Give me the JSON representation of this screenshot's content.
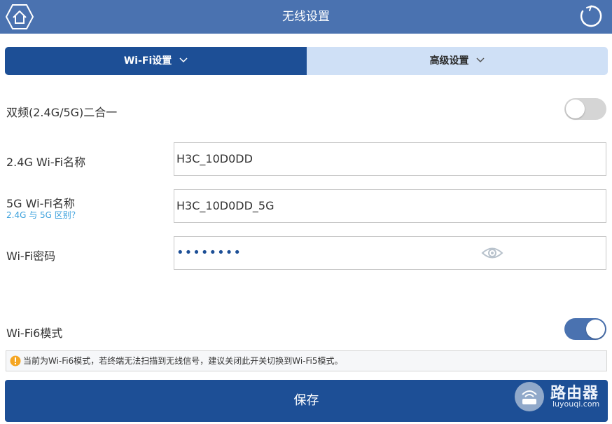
{
  "header": {
    "title": "无线设置"
  },
  "tabs": [
    {
      "label": "Wi-Fi设置",
      "active": true
    },
    {
      "label": "高级设置",
      "active": false
    }
  ],
  "dual_band": {
    "label": "双频(2.4G/5G)二合一",
    "enabled": false
  },
  "wifi24": {
    "label": "2.4G Wi-Fi名称",
    "value": "H3C_10D0DD"
  },
  "wifi5": {
    "label": "5G Wi-Fi名称",
    "help_link": "2.4G 与 5G 区别？",
    "value": "H3C_10D0DD_5G"
  },
  "password": {
    "label": "Wi-Fi密码",
    "masked_value": "••••••••"
  },
  "wifi6": {
    "label": "Wi-Fi6模式",
    "enabled": true
  },
  "notice": {
    "text": "当前为Wi-Fi6模式，若终端无法扫描到无线信号，建议关闭此开关切换到Wi-Fi5模式。"
  },
  "save_label": "保存",
  "watermark": {
    "title": "路由器",
    "subtitle": "luyouqi.com"
  },
  "colors": {
    "header": "#4a72b0",
    "primary": "#1d4f96",
    "tab_inactive": "#cfe0f6",
    "link": "#3aa0dc",
    "warning": "#f5a623"
  }
}
